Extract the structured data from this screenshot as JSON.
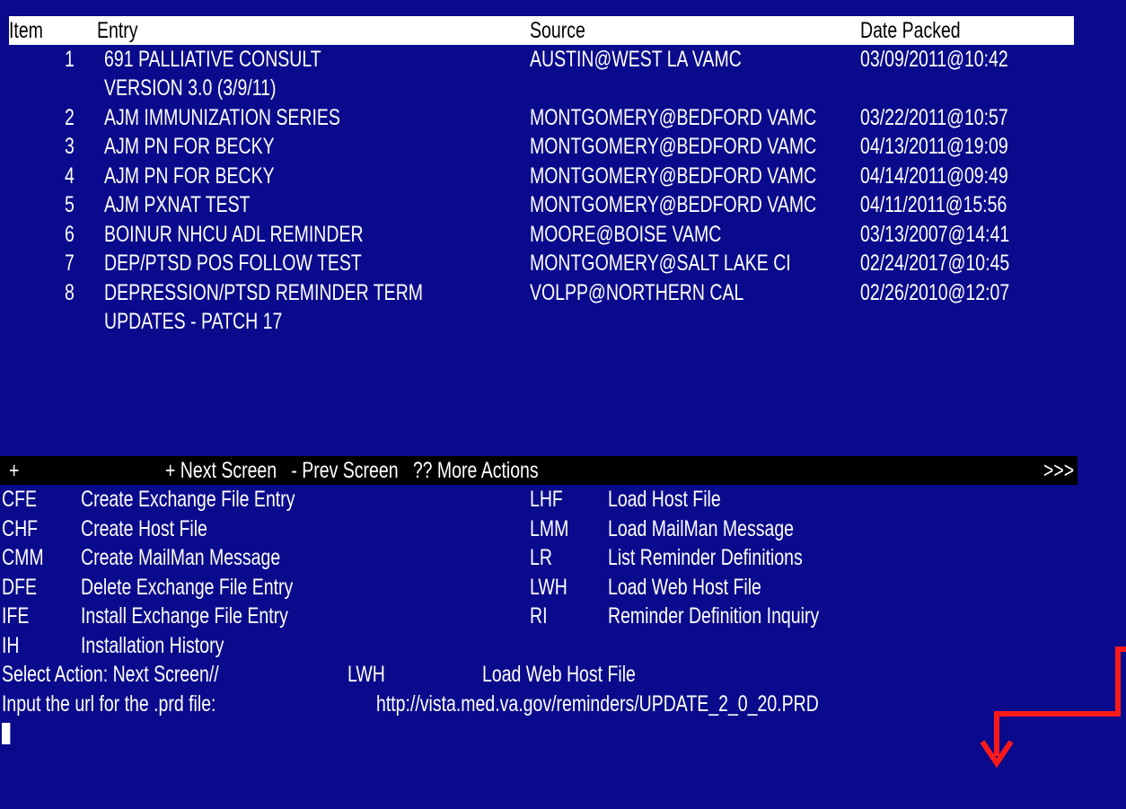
{
  "header": {
    "item": "Item",
    "entry": "Entry",
    "source": "Source",
    "date": "Date Packed"
  },
  "rows": [
    {
      "num": "1",
      "entry": "691 PALLIATIVE CONSULT",
      "source": "AUSTIN@WEST LA VAMC",
      "date": "03/09/2011@10:42"
    },
    {
      "num": "",
      "entry": "VERSION 3.0 (3/9/11)",
      "source": "",
      "date": ""
    },
    {
      "num": "2",
      "entry": "AJM IMMUNIZATION SERIES",
      "source": "MONTGOMERY@BEDFORD VAMC",
      "date": "03/22/2011@10:57"
    },
    {
      "num": "3",
      "entry": "AJM PN FOR BECKY",
      "source": "MONTGOMERY@BEDFORD VAMC",
      "date": "04/13/2011@19:09"
    },
    {
      "num": "4",
      "entry": "AJM PN FOR BECKY",
      "source": "MONTGOMERY@BEDFORD VAMC",
      "date": "04/14/2011@09:49"
    },
    {
      "num": "5",
      "entry": "AJM PXNAT TEST",
      "source": "MONTGOMERY@BEDFORD VAMC",
      "date": "04/11/2011@15:56"
    },
    {
      "num": "6",
      "entry": "BOINUR NHCU ADL REMINDER",
      "source": "MOORE@BOISE VAMC",
      "date": "03/13/2007@14:41"
    },
    {
      "num": "7",
      "entry": "DEP/PTSD POS FOLLOW TEST",
      "source": "MONTGOMERY@SALT LAKE CI",
      "date": "02/24/2017@10:45"
    },
    {
      "num": "8",
      "entry": "DEPRESSION/PTSD REMINDER TERM",
      "source": "VOLPP@NORTHERN CAL",
      "date": "02/26/2010@12:07"
    },
    {
      "num": "",
      "entry": "UPDATES - PATCH 17",
      "source": "",
      "date": ""
    }
  ],
  "navbar": {
    "plus": "+",
    "text": "+ Next Screen   - Prev Screen   ?? More Actions",
    "end": ">>>"
  },
  "actions": [
    {
      "code": "CFE",
      "label": "Create Exchange File Entry",
      "code2": "LHF",
      "label2": "Load Host File"
    },
    {
      "code": "CHF",
      "label": "Create Host File",
      "code2": "LMM",
      "label2": "Load MailMan Message"
    },
    {
      "code": "CMM",
      "label": "Create MailMan Message",
      "code2": "LR",
      "label2": "List Reminder Definitions"
    },
    {
      "code": "DFE",
      "label": "Delete Exchange File Entry",
      "code2": "LWH",
      "label2": "Load Web Host File"
    },
    {
      "code": "IFE",
      "label": "Install Exchange File Entry",
      "code2": "RI",
      "label2": "Reminder Definition Inquiry"
    },
    {
      "code": "IH",
      "label": "Installation History",
      "code2": "",
      "label2": ""
    }
  ],
  "prompt": {
    "select_label": "Select Action: Next Screen//",
    "select_value": "LWH",
    "select_echo": "Load Web Host File",
    "url_label": "Input the url for the .prd file:",
    "url_value": "http://vista.med.va.gov/reminders/UPDATE_2_0_20.PRD"
  },
  "colors": {
    "background": "#0a0a8c",
    "text": "#ffffff",
    "header_bg": "#ffffff",
    "header_text": "#000000",
    "navbar_bg": "#000000",
    "annotation": "#ff0000"
  }
}
